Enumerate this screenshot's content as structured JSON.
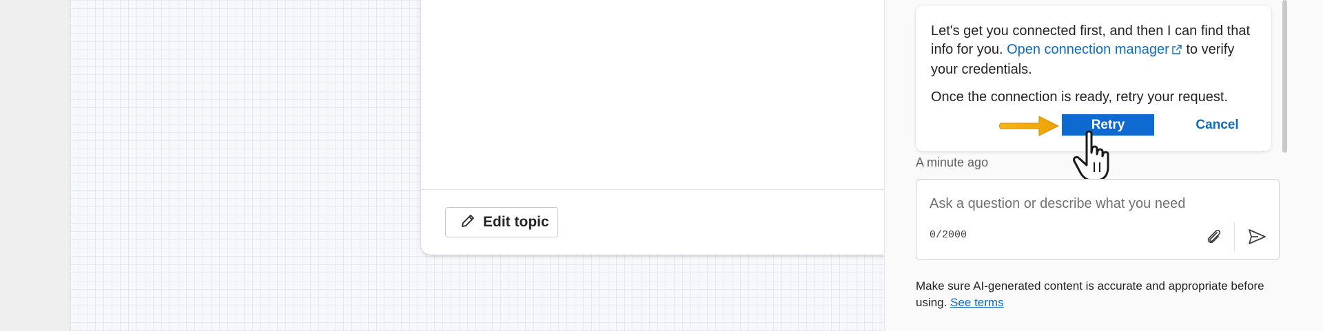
{
  "topic_card": {
    "edit_topic_label": "Edit topic",
    "icon": "pencil-icon"
  },
  "chat": {
    "message": {
      "line1_text": "Let's get you connected first, and then I can find that info for you. ",
      "link_text": "Open connection manager",
      "link_icon": "external-link-icon",
      "line1_suffix": " to verify your credentials.",
      "line2_text": "Once the connection is ready, retry your request.",
      "retry_label": "Retry",
      "cancel_label": "Cancel"
    },
    "timestamp": "A minute ago",
    "input": {
      "placeholder": "Ask a question or describe what you need",
      "char_count": "0/2000",
      "attach_icon": "paperclip-icon",
      "send_icon": "send-icon"
    },
    "disclaimer": {
      "text": "Make sure AI-generated content is accurate and appropriate before using. ",
      "terms_link": "See terms"
    }
  },
  "annotations": {
    "arrow": "arrow-right-icon",
    "cursor": "hand-pointer-icon"
  },
  "colors": {
    "accent": "#0f6cbd",
    "primary_button": "#0e6ad0",
    "arrow": "#f0a500"
  }
}
